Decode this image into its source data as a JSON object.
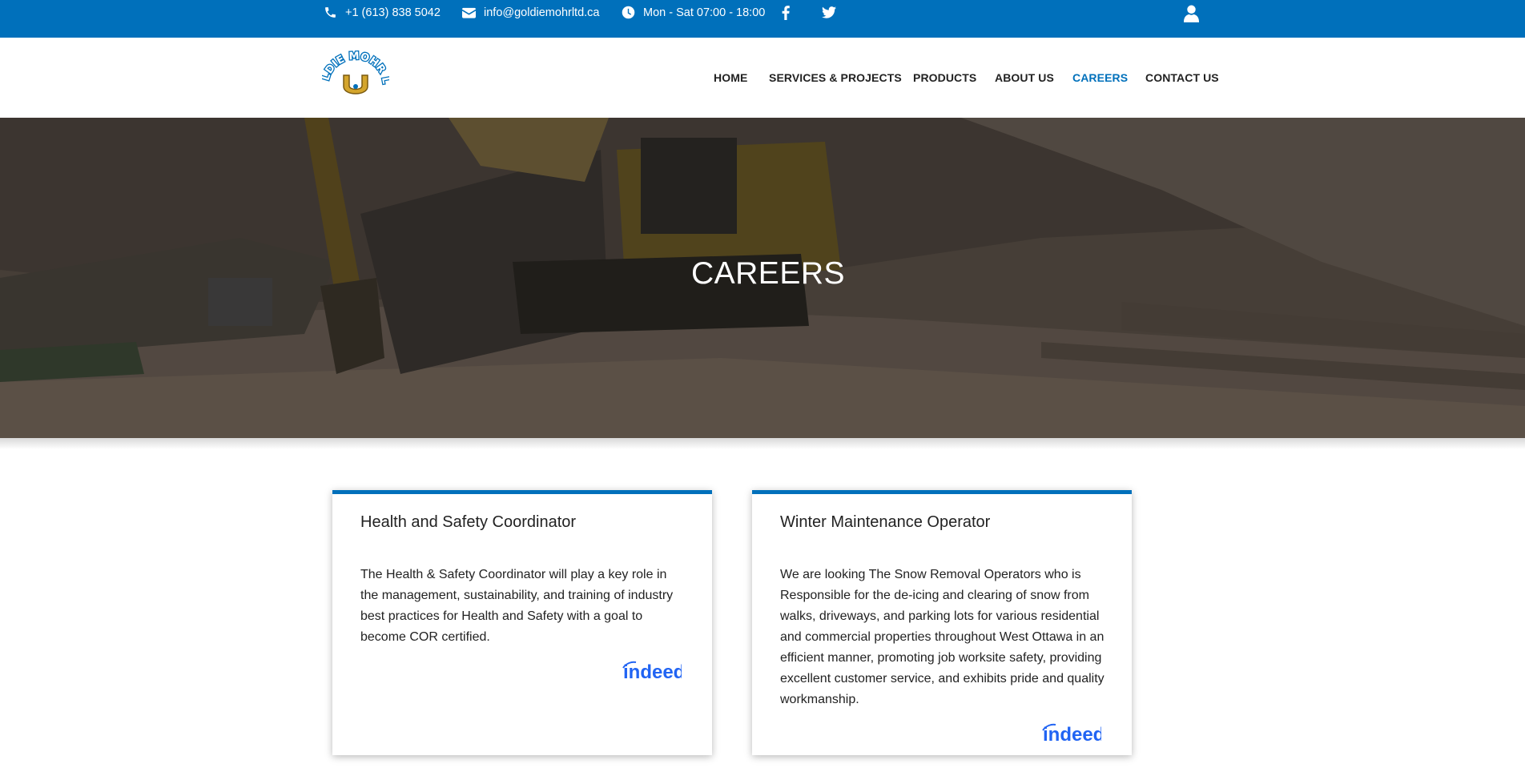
{
  "topbar": {
    "phone": "+1 (613) 838 5042",
    "email": "info@goldiemohrltd.ca",
    "hours": "Mon - Sat 07:00 - 18:00",
    "icons": [
      "phone-icon",
      "envelope-icon",
      "clock-icon",
      "facebook-icon",
      "twitter-icon",
      "user-icon"
    ]
  },
  "header": {
    "logo_text": "GOLDIE MOHR LTD",
    "nav": [
      "HOME",
      "SERVICES & PROJECTS",
      "PRODUCTS",
      "ABOUT US",
      "CAREERS",
      "CONTACT US"
    ],
    "active_nav": "CAREERS"
  },
  "hero": {
    "title": "CAREERS"
  },
  "jobs": [
    {
      "title": "Health and Safety Coordinator",
      "description": "The Health & Safety Coordinator will play a key role in the management, sustainability, and training of industry best practices for Health and Safety with a goal to become COR certified.",
      "apply_logo": "indeed"
    },
    {
      "title": "Winter Maintenance Operator",
      "description": "We are looking The Snow Removal Operators who is Responsible for the de-icing and clearing of snow from walks, driveways, and parking lots for various residential and commercial properties throughout West Ottawa in an efficient manner, promoting job worksite safety, providing excellent customer service, and exhibits pride and quality workmanship.",
      "apply_logo": "indeed"
    }
  ],
  "colors": {
    "brand_blue": "#0070bb",
    "indeed_blue": "#2164f3",
    "logo_gold": "#d4a52c"
  }
}
